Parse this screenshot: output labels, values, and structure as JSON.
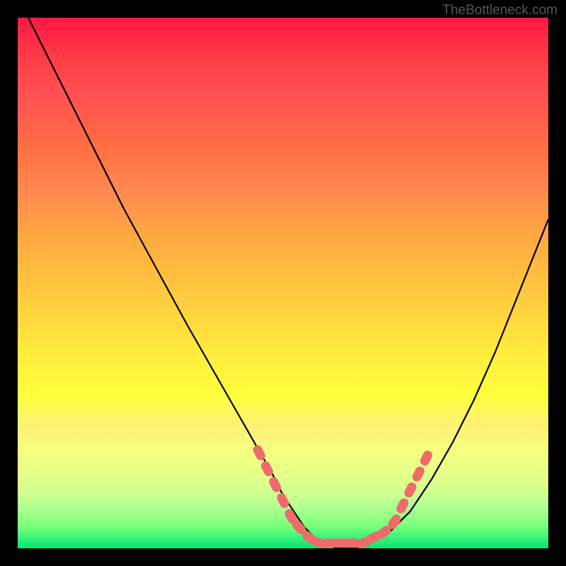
{
  "watermark": "TheBottleneck.com",
  "chart_data": {
    "type": "line",
    "title": "",
    "xlabel": "",
    "ylabel": "",
    "xlim": [
      0,
      100
    ],
    "ylim": [
      0,
      100
    ],
    "curve": {
      "name": "bottleneck-curve",
      "x": [
        2,
        8,
        14,
        20,
        26,
        32,
        36,
        40,
        44,
        48,
        50,
        52,
        54,
        56,
        58,
        60,
        62,
        64,
        66,
        70,
        74,
        78,
        82,
        86,
        90,
        94,
        98,
        100
      ],
      "y": [
        100,
        88,
        76,
        64,
        53,
        42,
        35,
        28,
        21,
        14,
        10,
        7,
        4,
        2,
        1,
        0,
        0,
        0,
        1,
        3,
        7,
        13,
        20,
        28,
        37,
        47,
        57,
        62
      ]
    },
    "markers": {
      "name": "highlight-dots",
      "color": "#ed6b6b",
      "points": [
        {
          "x": 45.5,
          "y": 18
        },
        {
          "x": 47.0,
          "y": 15
        },
        {
          "x": 48.5,
          "y": 12
        },
        {
          "x": 50.0,
          "y": 9
        },
        {
          "x": 51.5,
          "y": 6
        },
        {
          "x": 53.0,
          "y": 4
        },
        {
          "x": 55.0,
          "y": 2
        },
        {
          "x": 57.0,
          "y": 1
        },
        {
          "x": 59.0,
          "y": 1
        },
        {
          "x": 61.0,
          "y": 1
        },
        {
          "x": 63.0,
          "y": 1
        },
        {
          "x": 65.0,
          "y": 1
        },
        {
          "x": 67.0,
          "y": 2
        },
        {
          "x": 69.0,
          "y": 3
        },
        {
          "x": 71.0,
          "y": 5
        },
        {
          "x": 72.5,
          "y": 8
        },
        {
          "x": 74.0,
          "y": 11
        },
        {
          "x": 75.5,
          "y": 14
        },
        {
          "x": 77.0,
          "y": 17
        }
      ]
    }
  }
}
